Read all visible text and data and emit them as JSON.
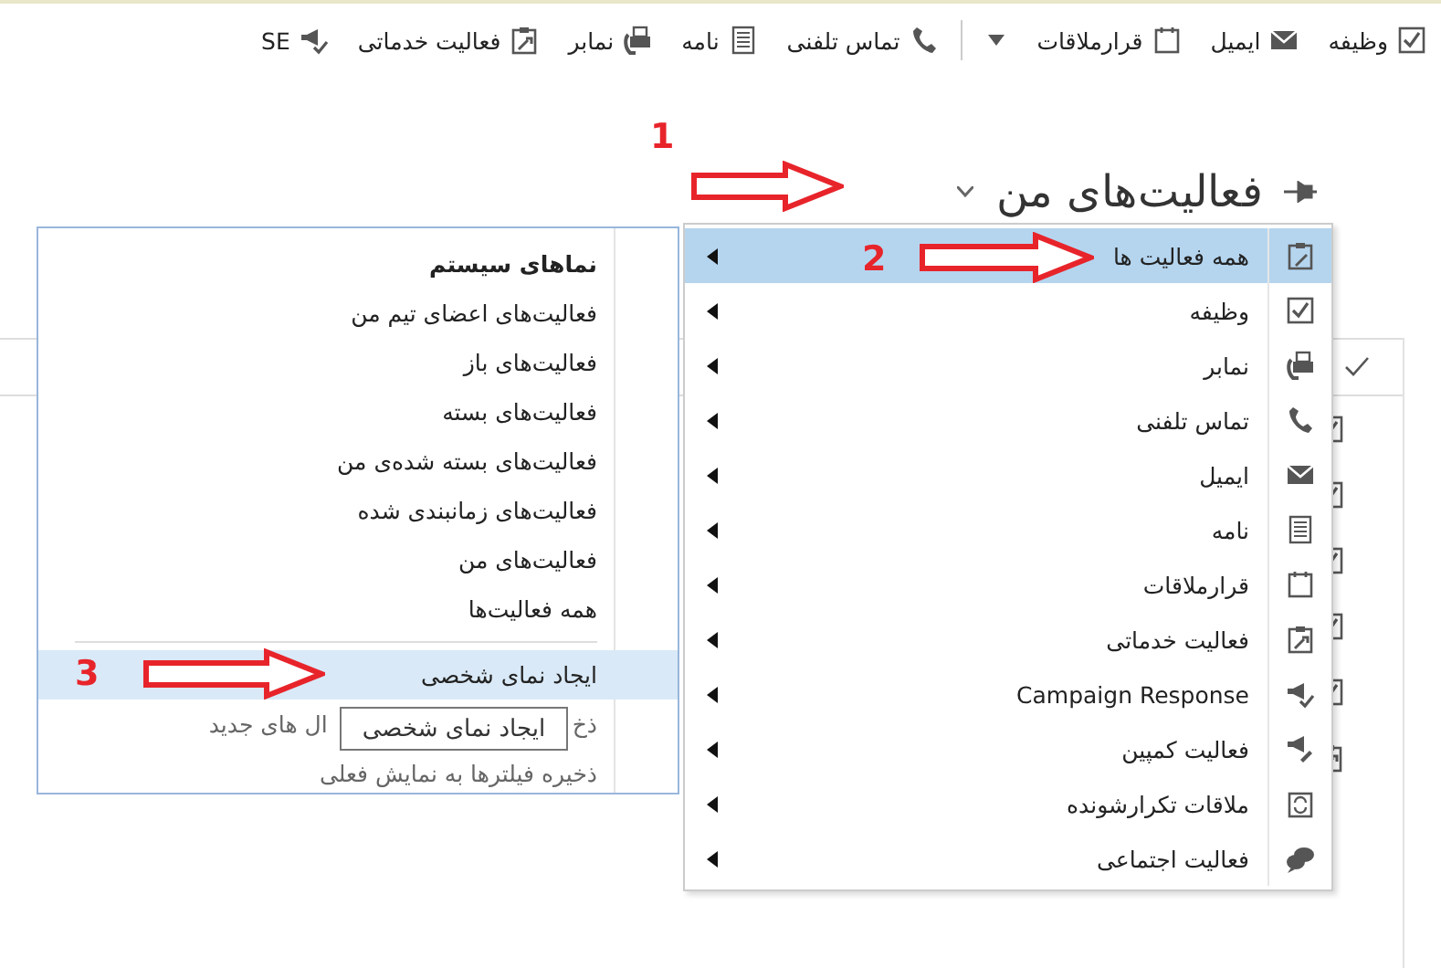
{
  "toolbar": {
    "items": [
      {
        "kind": "task",
        "label": "وظیفه"
      },
      {
        "kind": "email",
        "label": "ایمیل"
      },
      {
        "kind": "appointment",
        "label": "قرارملاقات"
      },
      {
        "kind": "more"
      },
      {
        "kind": "phone",
        "label": "تماس تلفنی"
      },
      {
        "kind": "letter",
        "label": "نامه"
      },
      {
        "kind": "fax",
        "label": "نمابر"
      },
      {
        "kind": "service",
        "label": "فعالیت خدماتی"
      },
      {
        "kind": "campaign_response",
        "label": "SE"
      }
    ]
  },
  "header": {
    "title": "فعالیت‌های من"
  },
  "background_list": {
    "rows": [
      {
        "kind": "task"
      },
      {
        "kind": "task"
      },
      {
        "kind": "task"
      },
      {
        "kind": "task"
      },
      {
        "kind": "task"
      },
      {
        "kind": "service"
      }
    ]
  },
  "view_menu": {
    "items": [
      {
        "kind": "all",
        "label": "همه فعالیت ها",
        "selected": true
      },
      {
        "kind": "task",
        "label": "وظیفه",
        "selected": false
      },
      {
        "kind": "fax",
        "label": "نمابر",
        "selected": false
      },
      {
        "kind": "phone",
        "label": "تماس تلفنی",
        "selected": false
      },
      {
        "kind": "email",
        "label": "ایمیل",
        "selected": false
      },
      {
        "kind": "letter",
        "label": "نامه",
        "selected": false
      },
      {
        "kind": "appointment",
        "label": "قرارملاقات",
        "selected": false
      },
      {
        "kind": "service",
        "label": "فعالیت خدماتی",
        "selected": false
      },
      {
        "kind": "campaign_response",
        "label": "Campaign Response",
        "selected": false
      },
      {
        "kind": "campaign_activity",
        "label": "فعالیت کمپین",
        "selected": false
      },
      {
        "kind": "recurring",
        "label": "ملاقات تکرارشونده",
        "selected": false
      },
      {
        "kind": "social",
        "label": "فعالیت اجتماعی",
        "selected": false
      }
    ]
  },
  "views_panel": {
    "heading": "نماهای سیستم",
    "views": [
      "فعالیت‌های اعضای تیم من",
      "فعالیت‌های باز",
      "فعالیت‌های بسته",
      "فعالیت‌های بسته شده‌ی من",
      "فعالیت‌های زمانبندی شده",
      "فعالیت‌های من",
      "همه فعالیت‌ها"
    ],
    "actions": [
      {
        "label": "ایجاد نمای شخصی",
        "selected": true
      },
      {
        "label_start": "ذخ",
        "label_end": "ال های جدید",
        "selected": false
      },
      {
        "label": "ذخیره فیلترها به نمایش فعلی",
        "selected": false
      }
    ],
    "tooltip": "ایجاد نمای شخصی"
  },
  "annotations": [
    "1",
    "2",
    "3"
  ]
}
